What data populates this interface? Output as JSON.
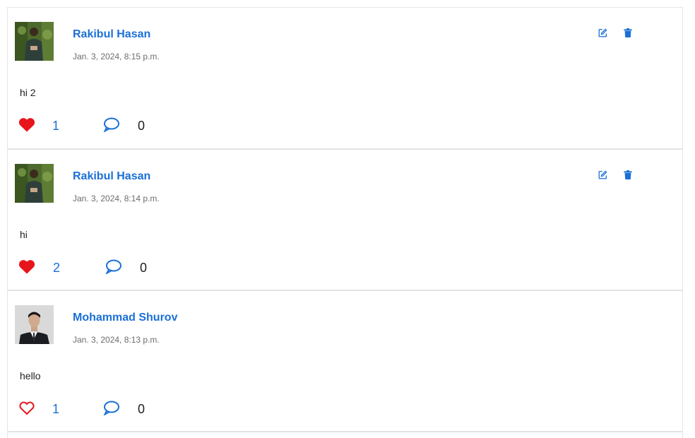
{
  "colors": {
    "accent": "#1a6fd6",
    "like_red": "#e8141b",
    "divider": "#e3e3e3"
  },
  "posts": [
    {
      "author": "Rakibul Hasan",
      "timestamp": "Jan. 3, 2024, 8:15 p.m.",
      "body": "hi 2",
      "likes": "1",
      "liked": true,
      "comments": "0",
      "can_edit": true,
      "avatar": "outdoor-portrait"
    },
    {
      "author": "Rakibul Hasan",
      "timestamp": "Jan. 3, 2024, 8:14 p.m.",
      "body": "hi",
      "likes": "2",
      "liked": true,
      "comments": "0",
      "can_edit": true,
      "avatar": "outdoor-portrait"
    },
    {
      "author": "Mohammad Shurov",
      "timestamp": "Jan. 3, 2024, 8:13 p.m.",
      "body": "hello",
      "likes": "1",
      "liked": false,
      "comments": "0",
      "can_edit": false,
      "avatar": "formal-portrait"
    }
  ],
  "icons": {
    "edit": "edit-icon",
    "delete": "trash-icon",
    "like": "heart-icon",
    "comment": "comment-bubble-icon"
  }
}
